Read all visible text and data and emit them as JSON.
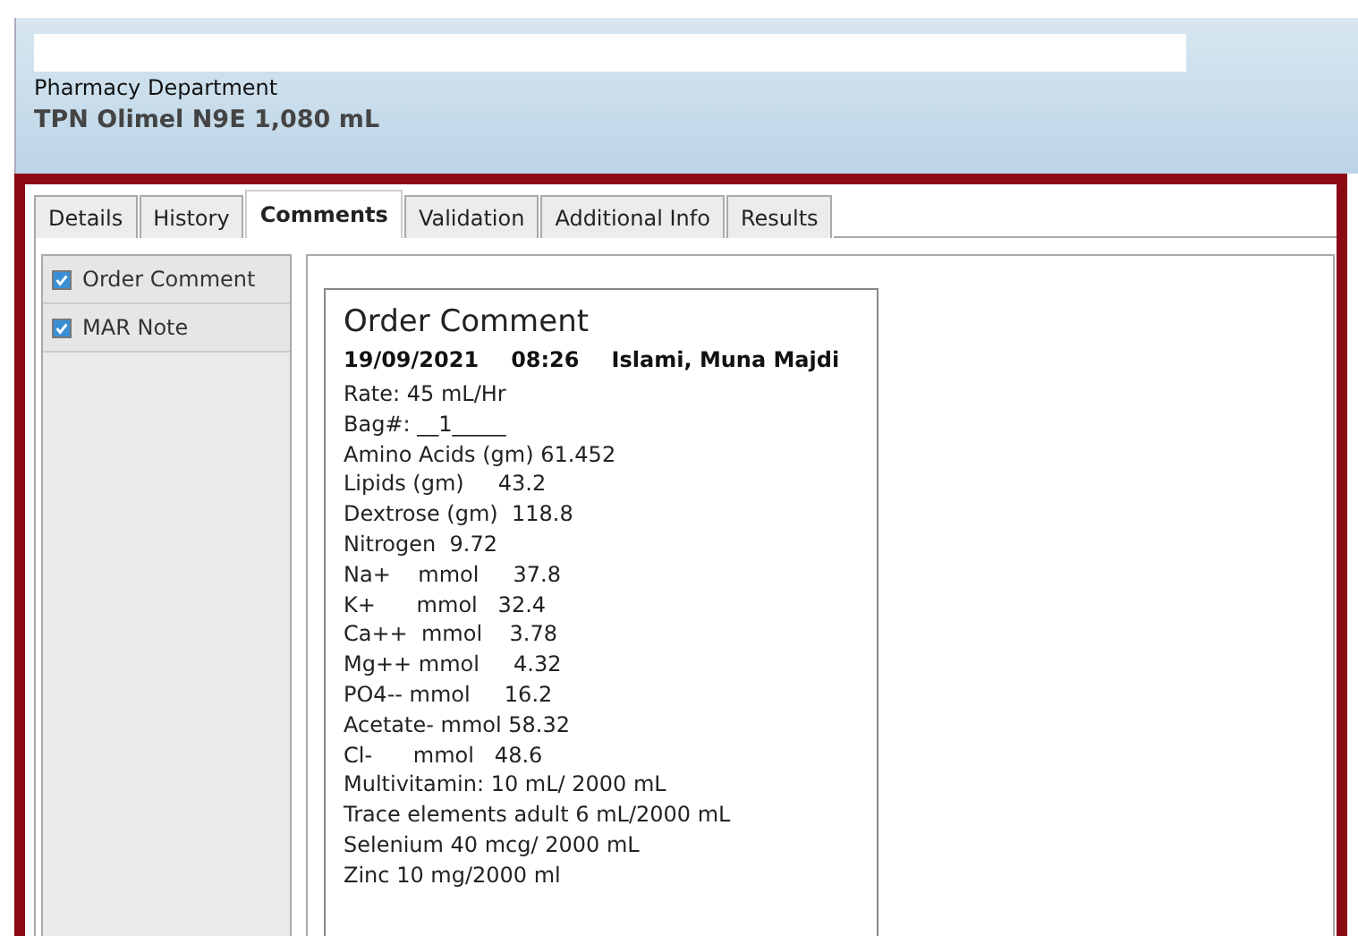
{
  "header": {
    "department": "Pharmacy Department",
    "order_title": "TPN Olimel N9E 1,080 mL"
  },
  "tabs": [
    {
      "label": "Details",
      "selected": false
    },
    {
      "label": "History",
      "selected": false
    },
    {
      "label": "Comments",
      "selected": true
    },
    {
      "label": "Validation",
      "selected": false
    },
    {
      "label": "Additional Info",
      "selected": false
    },
    {
      "label": "Results",
      "selected": false
    }
  ],
  "comment_types": [
    {
      "label": "Order Comment",
      "checked": true
    },
    {
      "label": "MAR Note",
      "checked": true
    }
  ],
  "comment": {
    "title": "Order Comment",
    "date": "19/09/2021",
    "time": "08:26",
    "author": "Islami, Muna Majdi",
    "lines": [
      "Rate: 45 mL/Hr",
      "Bag#: __1_____",
      "Amino Acids (gm) 61.452",
      "Lipids (gm)     43.2",
      "Dextrose (gm)  118.8",
      "Nitrogen  9.72",
      "Na+    mmol     37.8",
      "K+      mmol   32.4",
      "Ca++  mmol    3.78",
      "Mg++ mmol     4.32",
      "PO4-- mmol     16.2",
      "Acetate- mmol 58.32",
      "Cl-      mmol   48.6",
      "Multivitamin: 10 mL/ 2000 mL",
      "Trace elements adult 6 mL/2000 mL",
      "Selenium 40 mcg/ 2000 mL",
      "Zinc 10 mg/2000 ml"
    ]
  }
}
